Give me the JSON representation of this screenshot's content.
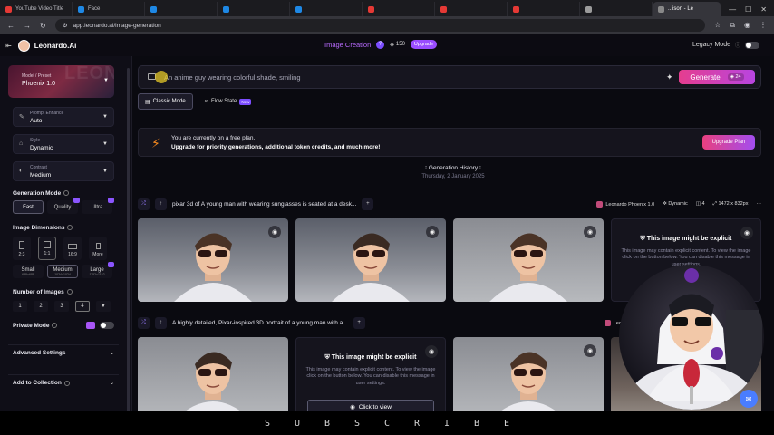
{
  "browser": {
    "tabs": [
      {
        "label": "YouTube Video Title",
        "color": "#e53935"
      },
      {
        "label": "Face",
        "color": "#1e88e5"
      },
      {
        "label": "",
        "color": "#1e88e5"
      },
      {
        "label": "",
        "color": "#1e88e5"
      },
      {
        "label": "",
        "color": "#1e88e5"
      },
      {
        "label": "",
        "color": "#e53935"
      },
      {
        "label": "",
        "color": "#e53935"
      },
      {
        "label": "",
        "color": "#e53935"
      },
      {
        "label": "",
        "color": "#9b9b9b"
      }
    ],
    "active_tab": "...ison - Le",
    "url": "app.leonardo.ai/image-generation"
  },
  "app": {
    "brand": "Leonardo.Ai",
    "section_title": "Image Creation",
    "token_count": "150",
    "upgrade_label": "Upgrade",
    "legacy_mode_label": "Legacy Mode"
  },
  "sidebar": {
    "model_label": "Model / Preset",
    "model_value": "Phoenix 1.0",
    "model_watermark": "LEONAR",
    "prompt_enhance_label": "Prompt Enhance",
    "prompt_enhance_value": "Auto",
    "style_label": "Style",
    "style_value": "Dynamic",
    "contrast_label": "Contrast",
    "contrast_value": "Medium",
    "generation_mode_title": "Generation Mode",
    "modes": [
      "Fast",
      "Quality",
      "Ultra"
    ],
    "image_dimensions_title": "Image Dimensions",
    "ratios": [
      "2:3",
      "1:1",
      "16:9",
      "More"
    ],
    "sizes": [
      {
        "label": "Small",
        "sub": "688×688"
      },
      {
        "label": "Medium",
        "sub": "1024×1024"
      },
      {
        "label": "Large",
        "sub": "1152×1152"
      }
    ],
    "number_of_images_title": "Number of Images",
    "numbers": [
      "1",
      "2",
      "3",
      "4"
    ],
    "private_mode_label": "Private Mode",
    "advanced_settings_label": "Advanced Settings",
    "add_to_collection_label": "Add to Collection"
  },
  "main": {
    "prompt_text": "An anime guy wearing colorful shade, smiling",
    "generate_label": "Generate",
    "generate_cost": "24",
    "classic_mode_label": "Classic Mode",
    "flow_state_label": "Flow State",
    "new_badge": "New",
    "banner_line1": "You are currently on a free plan.",
    "banner_line2": "Upgrade for priority generations, additional token credits, and much more!",
    "upgrade_plan_label": "Upgrade Plan",
    "history_title": "Generation History",
    "history_date": "Thursday, 2 January 2025",
    "row1_prompt": "pixar 3d of A young man with wearing sunglasses is seated at a desk...",
    "row1_model": "Leonardo Phoenix 1.0",
    "row1_style": "Dynamic",
    "row1_count": "4",
    "row1_size": "1472 x 832px",
    "row2_prompt": "A highly detailed, Pixar-inspired 3D portrait of a young man with a...",
    "row2_model": "Leonardo",
    "explicit_title": "This image might be explicit",
    "explicit_desc": "This image may contain explicit content. To view the image click on the button below. You can disable this message in user settings.",
    "explicit_desc_short": "This image may contain explicit content. To view the image click on the button below. You can disable this message in user settings.",
    "click_to_view": "Click to view"
  },
  "subscribe_letters": [
    "S",
    "U",
    "B",
    "S",
    "C",
    "R",
    "I",
    "B",
    "E"
  ],
  "colors": {
    "accent": "#e53d8f",
    "purple": "#9a4dff",
    "orange": "#f5891f"
  }
}
